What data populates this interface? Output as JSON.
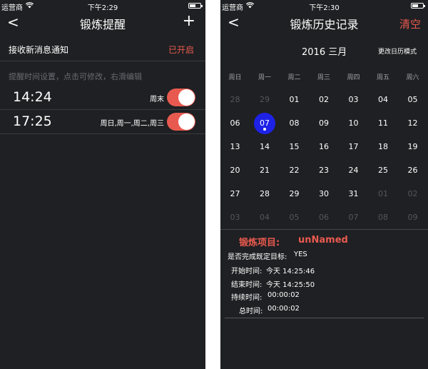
{
  "left": {
    "status": {
      "carrier": "运营商",
      "time": "下午2:29",
      "battery_level": 0.6
    },
    "nav": {
      "title": "锻炼提醒",
      "back": "<",
      "add": "+"
    },
    "notify": {
      "label": "接收新消息通知",
      "status": "已开启"
    },
    "hint": "提醒时间设置，点击可修改，右滑编辑",
    "alarms": [
      {
        "time": "14:24",
        "days": "周末",
        "enabled": true
      },
      {
        "time": "17:25",
        "days": "周日,周一,周二,周三",
        "enabled": true
      }
    ]
  },
  "right": {
    "status": {
      "carrier": "运营商",
      "time": "下午2:30",
      "battery_level": 0.6
    },
    "nav": {
      "title": "锻炼历史记录",
      "back": "<",
      "clear": "清空"
    },
    "calendar": {
      "month_label": "2016 三月",
      "mode_label": "更改日历模式",
      "weekdays": [
        "周日",
        "周一",
        "周二",
        "周三",
        "周四",
        "周五",
        "周六"
      ],
      "weeks": [
        [
          "28",
          "29",
          "01",
          "02",
          "03",
          "04",
          "05"
        ],
        [
          "06",
          "07",
          "08",
          "09",
          "10",
          "11",
          "12"
        ],
        [
          "13",
          "14",
          "15",
          "16",
          "17",
          "18",
          "19"
        ],
        [
          "20",
          "21",
          "22",
          "23",
          "24",
          "25",
          "26"
        ],
        [
          "27",
          "28",
          "29",
          "30",
          "31",
          "01",
          "02"
        ],
        [
          "03",
          "04",
          "05",
          "06",
          "07",
          "08",
          "09"
        ]
      ],
      "selected_day": "07"
    },
    "detail": {
      "title_label": "锻炼项目:",
      "title_value": "unNamed",
      "goal_label": "是否完成既定目标:",
      "goal_value": "YES",
      "start_label": "开始时间:",
      "start_value": "今天 14:25:46",
      "end_label": "结束时间:",
      "end_value": "今天 14:25:50",
      "duration_label": "持续时间:",
      "duration_value": "00:00:02",
      "total_label": "总时间:",
      "total_value": "00:00:02"
    }
  },
  "colors": {
    "background": "#1f2023",
    "accent": "#e85a4f",
    "selection": "#1e22e6",
    "muted": "#55565b"
  }
}
